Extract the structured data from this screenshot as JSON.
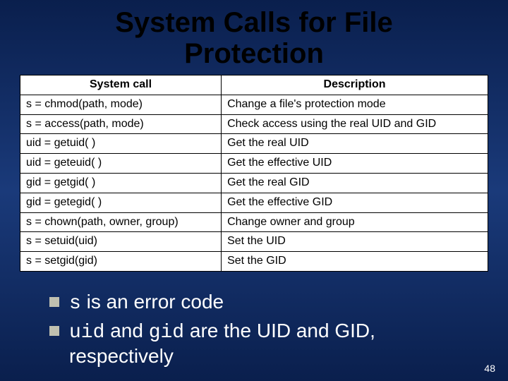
{
  "title": "System Calls for File Protection",
  "table": {
    "headers": [
      "System call",
      "Description"
    ],
    "rows": [
      [
        "s = chmod(path, mode)",
        "Change a file's protection mode"
      ],
      [
        "s = access(path, mode)",
        "Check access using the real UID and GID"
      ],
      [
        "uid = getuid( )",
        "Get the real UID"
      ],
      [
        "uid = geteuid( )",
        "Get the effective UID"
      ],
      [
        "gid = getgid( )",
        "Get the real GID"
      ],
      [
        "gid = getegid( )",
        "Get the effective GID"
      ],
      [
        "s = chown(path, owner, group)",
        "Change owner and group"
      ],
      [
        "s = setuid(uid)",
        "Set the UID"
      ],
      [
        "s = setgid(gid)",
        "Set the GID"
      ]
    ]
  },
  "bullets": [
    {
      "code": "s",
      "rest": " is an error code"
    },
    {
      "code": "uid",
      "mid": " and ",
      "code2": "gid",
      "rest": " are the UID and GID, respectively"
    }
  ],
  "page_number": "48"
}
